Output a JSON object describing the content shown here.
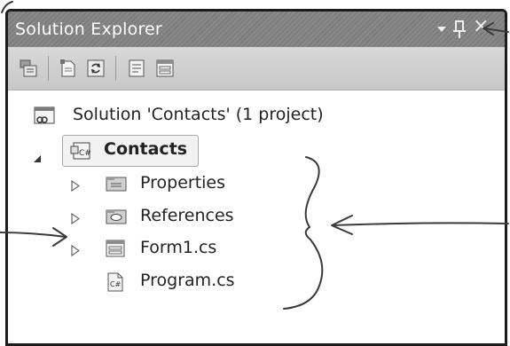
{
  "panel": {
    "title": "Solution Explorer",
    "title_icons": [
      "dropdown-icon",
      "pin-icon",
      "close-icon"
    ]
  },
  "toolbar": {
    "buttons": [
      "properties-icon",
      "show-all-files-icon",
      "refresh-icon",
      "view-code-icon",
      "view-designer-icon"
    ]
  },
  "tree": {
    "solution": "Solution 'Contacts' (1 project)",
    "project": "Contacts",
    "items": [
      "Properties",
      "References",
      "Form1.cs",
      "Program.cs"
    ]
  },
  "colors": {
    "titlebar": "#8a8a8a",
    "toolbar": "#d0d0d0",
    "text": "#222222",
    "ink": "#3a3a3a"
  }
}
